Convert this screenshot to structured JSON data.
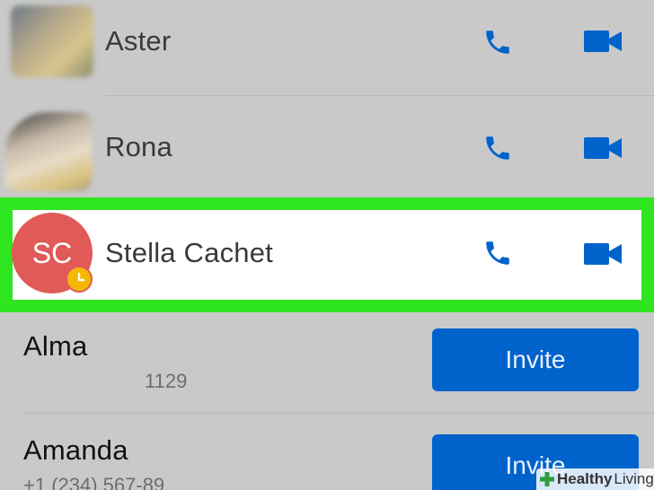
{
  "contacts": [
    {
      "name": "Aster"
    },
    {
      "name": "Rona"
    },
    {
      "name": "Stella Cachet",
      "initials": "SC"
    }
  ],
  "invites": [
    {
      "name": "Alma",
      "detail": "1129",
      "button": "Invite"
    },
    {
      "name": "Amanda",
      "detail": "+1 (234) 567-89",
      "button": "Invite"
    }
  ],
  "watermark": {
    "brand": "Healthy",
    "suffix": "Living"
  },
  "colors": {
    "highlight": "#2fe51f",
    "call_icon": "#0063cc",
    "invite_button": "#0063cc",
    "avatar": "#e05a58",
    "badge": "#f5b800"
  },
  "icons": {
    "call": "phone-icon",
    "video": "video-camera-icon",
    "badge": "clock-icon"
  }
}
